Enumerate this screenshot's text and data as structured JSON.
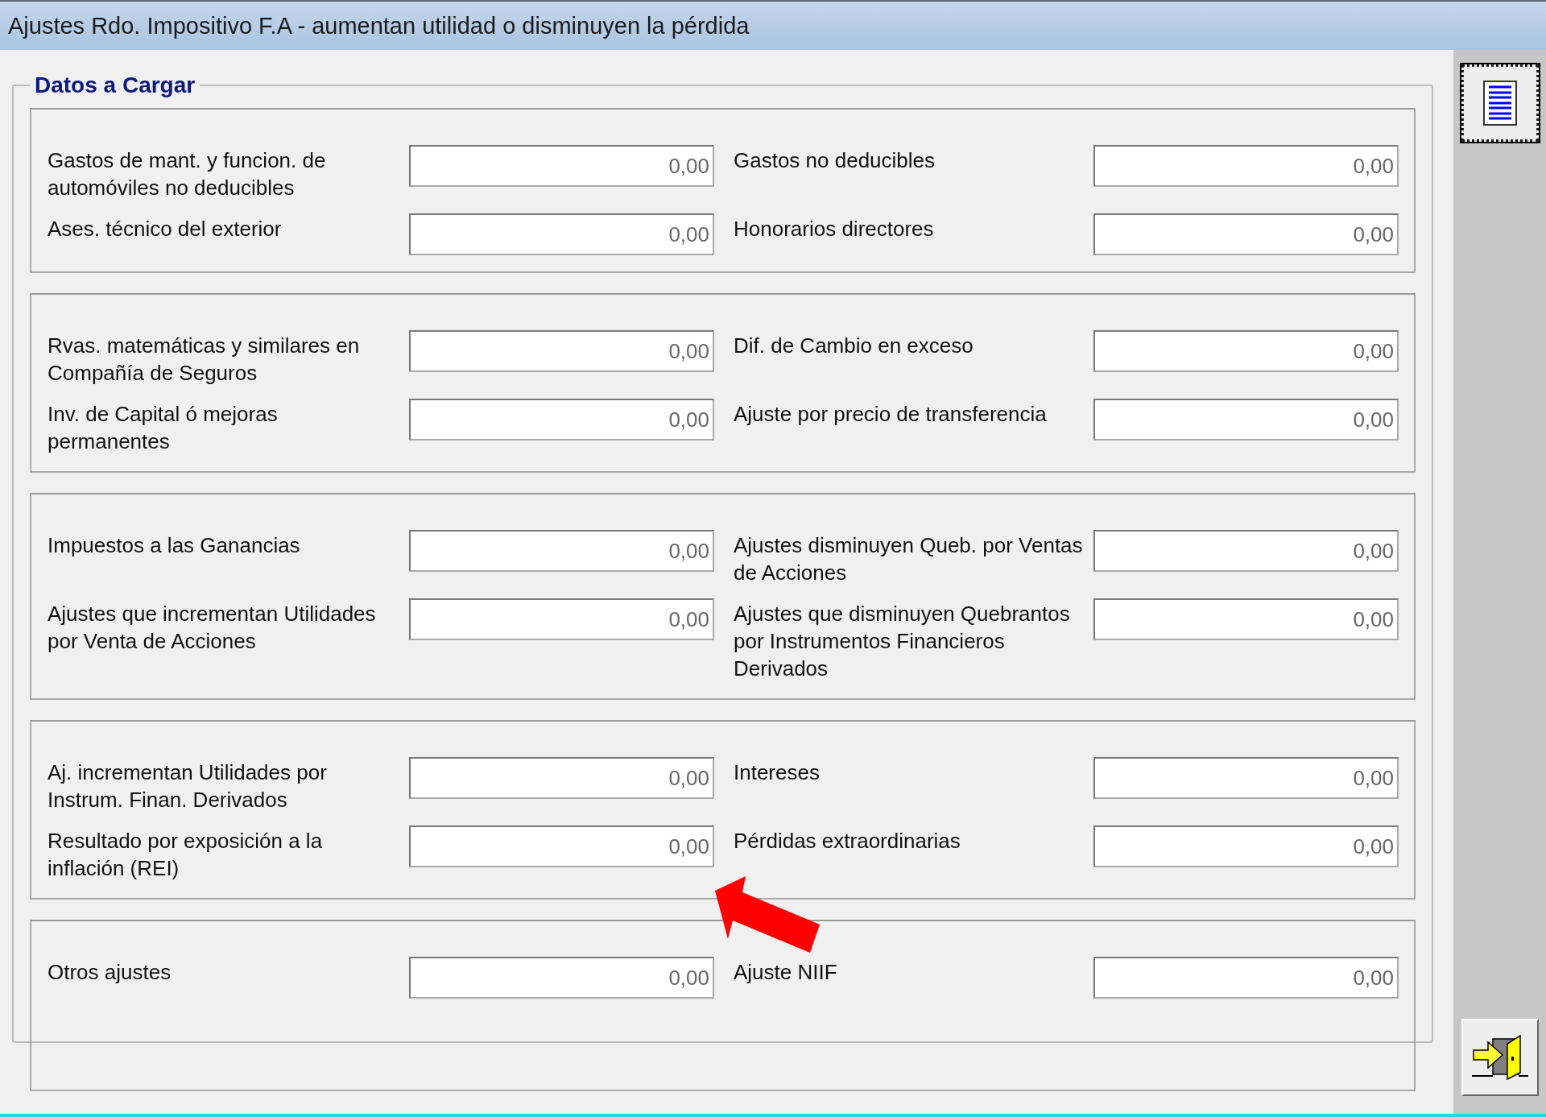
{
  "window": {
    "title": "Ajustes Rdo. Impositivo F.A - aumentan utilidad o disminuyen la pérdida"
  },
  "form": {
    "legend": "Datos a Cargar",
    "groups": [
      {
        "rows": [
          {
            "left": {
              "label": "Gastos de mant. y funcion. de automóviles no deducibles",
              "value": "0,00"
            },
            "right": {
              "label": "Gastos no deducibles",
              "value": "0,00"
            }
          },
          {
            "left": {
              "label": "Ases. técnico del exterior",
              "value": "0,00"
            },
            "right": {
              "label": "Honorarios directores",
              "value": "0,00"
            }
          }
        ]
      },
      {
        "rows": [
          {
            "left": {
              "label": "Rvas. matemáticas y similares en Compañía de Seguros",
              "value": "0,00"
            },
            "right": {
              "label": "Dif. de Cambio en exceso",
              "value": "0,00"
            }
          },
          {
            "left": {
              "label": "Inv. de Capital ó mejoras permanentes",
              "value": "0,00"
            },
            "right": {
              "label": "Ajuste por precio de transferencia",
              "value": "0,00"
            }
          }
        ]
      },
      {
        "rows": [
          {
            "left": {
              "label": "Impuestos a las Ganancias",
              "value": "0,00"
            },
            "right": {
              "label": "Ajustes disminuyen Queb. por Ventas de Acciones",
              "value": "0,00"
            }
          },
          {
            "left": {
              "label": "Ajustes que incrementan Utilidades por Venta de Acciones",
              "value": "0,00"
            },
            "right": {
              "label": "Ajustes que disminuyen Quebrantos por Instrumentos Financieros Derivados",
              "value": "0,00"
            }
          }
        ]
      },
      {
        "rows": [
          {
            "left": {
              "label": "Aj.  incrementan Utilidades por Instrum. Finan. Derivados",
              "value": "0,00"
            },
            "right": {
              "label": "Intereses",
              "value": "0,00"
            }
          },
          {
            "left": {
              "label": "Resultado por exposición a la inflación (REI)",
              "value": "0,00"
            },
            "right": {
              "label": "Pérdidas extraordinarias",
              "value": "0,00"
            }
          }
        ]
      },
      {
        "rows": [
          {
            "left": {
              "label": "Otros ajustes",
              "value": "0,00"
            },
            "right": {
              "label": "Ajuste NIIF",
              "value": "0,00"
            }
          }
        ]
      }
    ]
  }
}
